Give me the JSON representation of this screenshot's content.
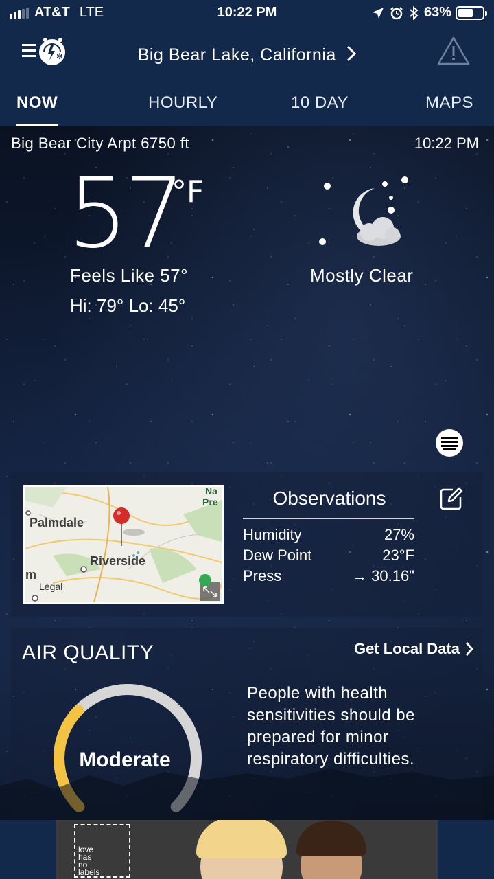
{
  "status_bar": {
    "carrier": "AT&T",
    "network": "LTE",
    "time": "10:22 PM",
    "battery_percent": "63%",
    "battery_level": 0.63,
    "signal_bars_filled": 3,
    "signal_bars_total": 5
  },
  "header": {
    "location": "Big Bear Lake, California",
    "menu_icon": "menu-logo-icon",
    "alert_icon": "warning-icon"
  },
  "tabs": [
    {
      "label": "NOW",
      "active": true
    },
    {
      "label": "HOURLY",
      "active": false
    },
    {
      "label": "10 DAY",
      "active": false
    },
    {
      "label": "MAPS",
      "active": false
    }
  ],
  "current": {
    "station": "Big Bear City Arpt 6750 ft",
    "obs_time": "10:22 PM",
    "temperature": "57",
    "unit": "°F",
    "feels_like": "Feels Like 57°",
    "hi_lo": "Hi: 79° Lo: 45°",
    "condition": "Mostly Clear",
    "condition_icon": "moon-cloud-icon"
  },
  "map": {
    "labels": [
      "Palmdale",
      "Riverside"
    ],
    "corner_labels": [
      "Na",
      "Pre"
    ],
    "legal": "Legal",
    "partial_label": "m"
  },
  "observations": {
    "title": "Observations",
    "rows": [
      {
        "label": "Humidity",
        "value": "27%"
      },
      {
        "label": "Dew Point",
        "value": "23°F"
      },
      {
        "label": "Press",
        "value": "→ 30.16\""
      }
    ]
  },
  "air_quality": {
    "title": "AIR QUALITY",
    "link": "Get Local Data",
    "level": "Moderate",
    "gauge_fraction": 0.33,
    "description": "People with health sensitivities should be prepared for minor respiratory difficulties."
  },
  "ad": {
    "text_lines": [
      "love",
      "has",
      "no",
      "labels"
    ]
  },
  "colors": {
    "header_bg": "#13294b",
    "gauge_active": "#f5c343",
    "gauge_track": "#d6d6d6"
  }
}
